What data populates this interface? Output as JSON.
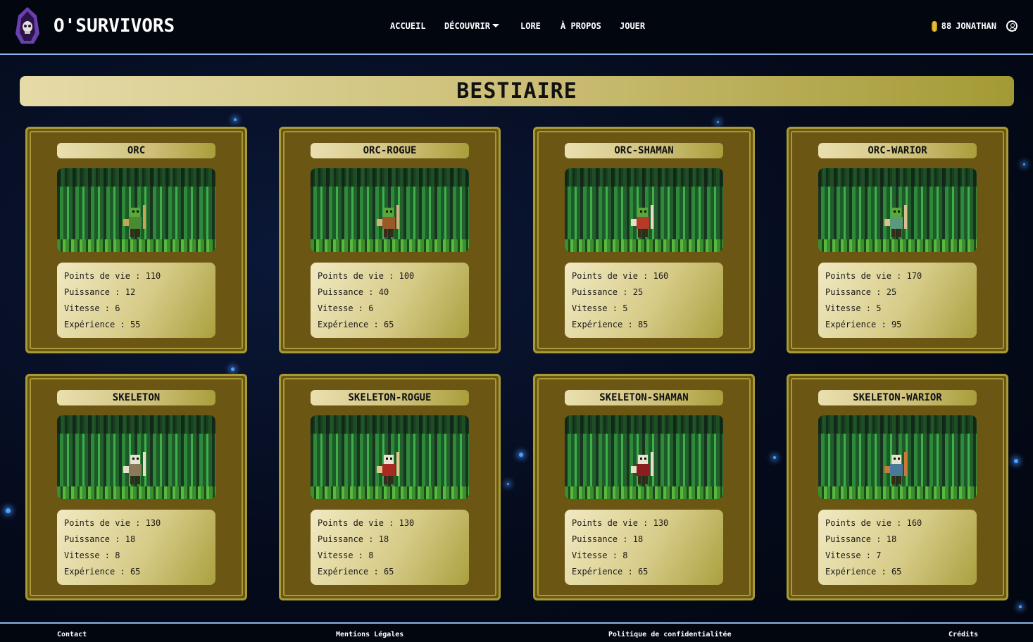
{
  "brand": {
    "name": "O'SURVIVORS",
    "logo_icon": "hooded-skull-icon"
  },
  "nav": {
    "items": [
      {
        "label": "ACCUEIL"
      },
      {
        "label": "DÉCOUVRIR"
      },
      {
        "label": "LORE"
      },
      {
        "label": "À PROPOS"
      },
      {
        "label": "JOUER"
      }
    ]
  },
  "user": {
    "coins": "88",
    "name": "JONATHAN",
    "coin_icon": "coin-icon",
    "profile_icon": "user-circle-icon"
  },
  "page": {
    "title": "BESTIAIRE"
  },
  "stat_labels": {
    "hp": "Points de vie :",
    "power": "Puissance :",
    "speed": "Vitesse :",
    "xp": "Expérience :"
  },
  "creatures": [
    {
      "name": "ORC",
      "hp": "110",
      "power": "12",
      "speed": "6",
      "xp": "55",
      "body": "#4a8a34",
      "accent": "#c8a455"
    },
    {
      "name": "ORC-ROGUE",
      "hp": "100",
      "power": "40",
      "speed": "6",
      "xp": "65",
      "body": "#9a5a28",
      "accent": "#d2b080"
    },
    {
      "name": "ORC-SHAMAN",
      "hp": "160",
      "power": "25",
      "speed": "5",
      "xp": "85",
      "body": "#b53a28",
      "accent": "#e8dcc8"
    },
    {
      "name": "ORC-WARIOR",
      "hp": "170",
      "power": "25",
      "speed": "5",
      "xp": "95",
      "body": "#5a9a7a",
      "accent": "#d8c28a"
    },
    {
      "name": "SKELETON",
      "hp": "130",
      "power": "18",
      "speed": "8",
      "xp": "65",
      "body": "#8a7a5a",
      "accent": "#e8e0cc"
    },
    {
      "name": "SKELETON-ROGUE",
      "hp": "130",
      "power": "18",
      "speed": "8",
      "xp": "65",
      "body": "#a82a22",
      "accent": "#e0c890"
    },
    {
      "name": "SKELETON-SHAMAN",
      "hp": "130",
      "power": "18",
      "speed": "8",
      "xp": "65",
      "body": "#8a1e1e",
      "accent": "#e8e0cc"
    },
    {
      "name": "SKELETON-WARIOR",
      "hp": "160",
      "power": "18",
      "speed": "7",
      "xp": "65",
      "body": "#4a7a9a",
      "accent": "#c87a3a"
    }
  ],
  "footer": {
    "links": [
      {
        "label": "Contact"
      },
      {
        "label": "Mentions Légales"
      },
      {
        "label": "Politique de confidentialitée"
      },
      {
        "label": "Crédits"
      }
    ]
  }
}
